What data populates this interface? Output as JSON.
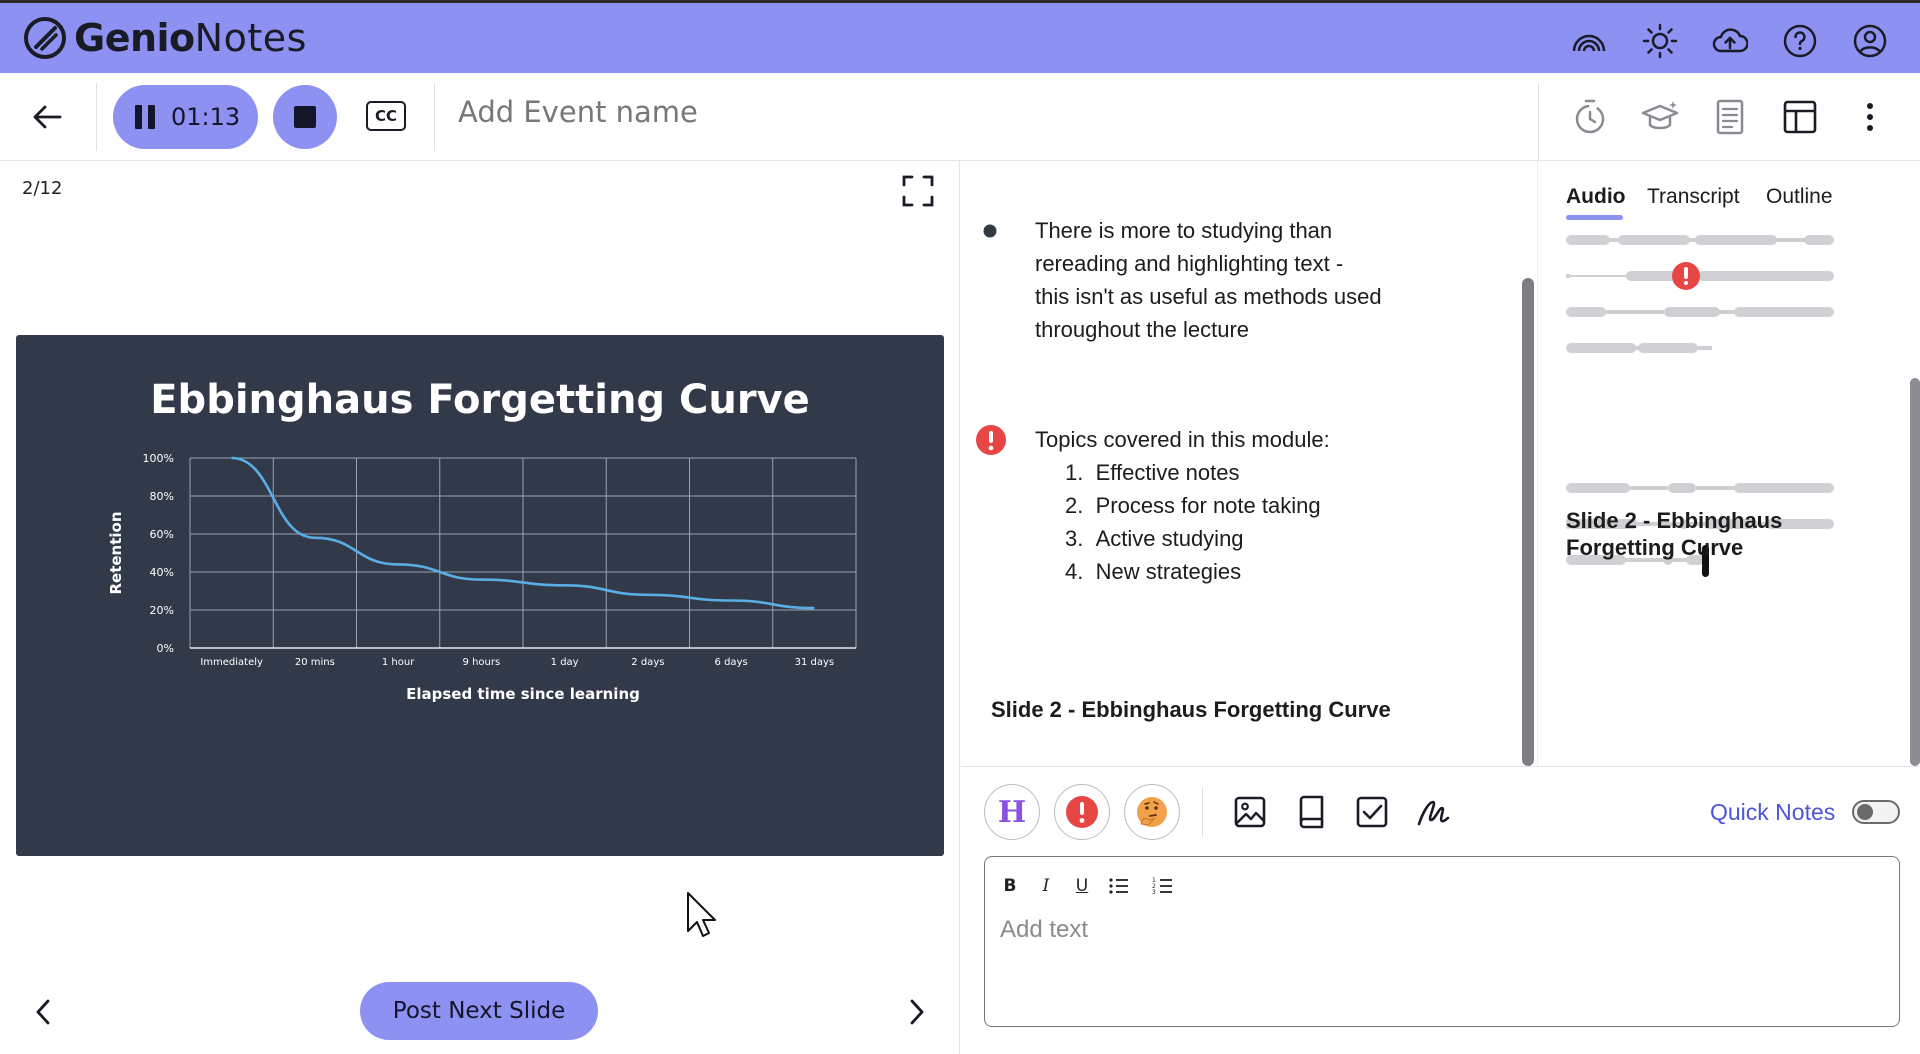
{
  "app": {
    "name_bold": "Genio",
    "name_light": "Notes"
  },
  "toolbar": {
    "timer": "01:13",
    "cc_label": "CC",
    "event_placeholder": "Add Event name"
  },
  "slide_pane": {
    "page_indicator": "2/12",
    "post_button": "Post Next Slide"
  },
  "chart_data": {
    "type": "line",
    "title": "Ebbinghaus Forgetting Curve",
    "xlabel": "Elapsed time since learning",
    "ylabel": "Retention",
    "categories": [
      "Immediately",
      "20 mins",
      "1 hour",
      "9 hours",
      "1 day",
      "2 days",
      "6 days",
      "31 days"
    ],
    "y_ticks": [
      "0%",
      "20%",
      "40%",
      "60%",
      "80%",
      "100%"
    ],
    "ylim": [
      0,
      100
    ],
    "grid": true,
    "series": [
      {
        "values": [
          100,
          58,
          44,
          36,
          33,
          28,
          25,
          21
        ]
      }
    ],
    "colors": {
      "line": "#5aaee6",
      "background": "#323949"
    }
  },
  "notes": {
    "bullet_text_lines": [
      "There is more to studying than",
      "rereading and highlighting text -",
      "this isn't as useful as methods used",
      "throughout the lecture"
    ],
    "important_heading": "Topics covered in this module:",
    "important_items": [
      "Effective notes",
      "Process for note taking",
      "Active studying",
      "New strategies"
    ],
    "slide_heading": "Slide 2 - Ebbinghaus Forgetting Curve"
  },
  "outline": {
    "tabs": [
      "Audio",
      "Transcript",
      "Outline"
    ],
    "active_tab": "Audio",
    "slide_heading": "Slide 2 - Ebbinghaus Forgetting Curve"
  },
  "editor": {
    "heading_button": "H",
    "quick_notes_label": "Quick Notes",
    "quick_notes_on": false,
    "format_buttons": [
      "B",
      "I",
      "U"
    ],
    "placeholder": "Add text"
  },
  "colors": {
    "accent": "#8d91f2",
    "important": "#e84545",
    "link": "#4b55d8"
  }
}
